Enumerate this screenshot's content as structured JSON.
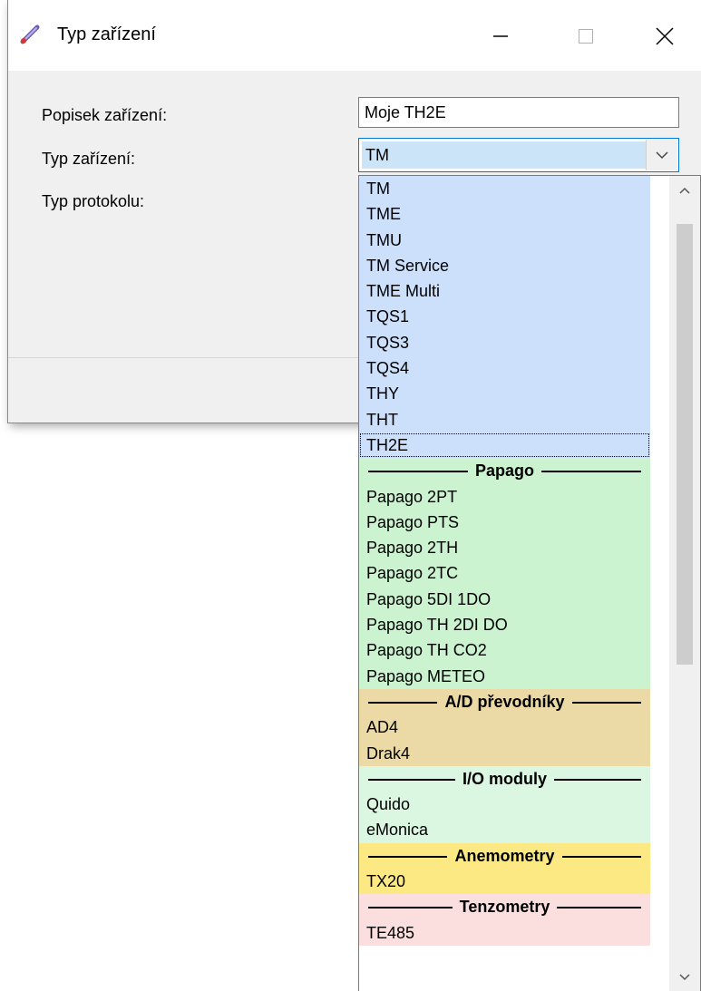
{
  "window": {
    "title": "Typ zařízení"
  },
  "form": {
    "label_popisek": "Popisek zařízení:",
    "popisek_value": "Moje TH2E",
    "label_typ": "Typ zařízení:",
    "typ_value": "TM",
    "label_protokol": "Typ protokolu:"
  },
  "dropdown": {
    "colors": {
      "tm": "#cce0fb",
      "papago": "#cbf3d0",
      "ad": "#ecdaa6",
      "io": "#dbf7e2",
      "anemo": "#fce984",
      "tenzo": "#fbdede"
    },
    "tm_items": [
      "TM",
      "TME",
      "TMU",
      "TM Service",
      "TME Multi",
      "TQS1",
      "TQS3",
      "TQS4",
      "THY",
      "THT",
      "TH2E"
    ],
    "papago_header": "Papago",
    "papago_items": [
      "Papago 2PT",
      "Papago PTS",
      "Papago 2TH",
      "Papago 2TC",
      "Papago 5DI 1DO",
      "Papago TH 2DI DO",
      "Papago TH CO2",
      "Papago METEO"
    ],
    "ad_header": "A/D převodníky",
    "ad_items": [
      "AD4",
      "Drak4"
    ],
    "io_header": "I/O moduly",
    "io_items": [
      "Quido",
      "eMonica"
    ],
    "anemo_header": "Anemometry",
    "anemo_items": [
      "TX20"
    ],
    "tenzo_header": "Tenzometry",
    "tenzo_items": [
      "TE485"
    ]
  }
}
